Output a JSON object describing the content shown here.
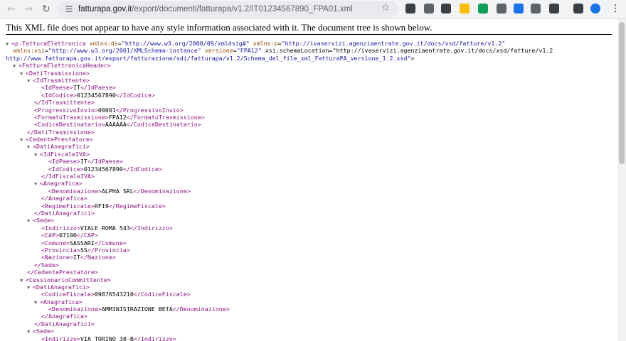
{
  "browser": {
    "url_host": "fatturapa.gov.it",
    "url_path": "/export/documenti/fatturapa/v1.2/IT01234567890_FPA01.xml"
  },
  "icons": {
    "back": "back-arrow-icon",
    "forward": "forward-arrow-icon",
    "reload": "reload-icon",
    "site_info": "tune-icon",
    "bookmark": "star-icon"
  },
  "extensions": [
    {
      "name": "extension-icon-1",
      "color": "#3c4043"
    },
    {
      "name": "extension-icon-2",
      "color": "#5f6368"
    },
    {
      "name": "extension-icon-3",
      "color": "#3c4043"
    },
    {
      "name": "extension-icon-4",
      "color": "#fbbc04"
    },
    {
      "name": "extension-icon-5",
      "color": "#0f9d58"
    },
    {
      "name": "extension-icon-6",
      "color": "#5f6368"
    },
    {
      "name": "extension-icon-7",
      "color": "#1a73e8"
    },
    {
      "name": "extension-icon-8",
      "color": "#5f6368"
    },
    {
      "name": "extension-icon-9",
      "color": "#3c4043"
    },
    {
      "name": "side-panel-icon",
      "color": "#3c4043"
    },
    {
      "name": "profile-avatar-icon",
      "color": "#1a73e8"
    },
    {
      "name": "menu-icon",
      "color": "#5f6368"
    }
  ],
  "page": {
    "header_message": "This XML file does not appear to have any style information associated with it. The document tree is shown below."
  },
  "tree_lines": [
    "▼<p:FatturaElettronica xmlns:ds=\"http://www.w3.org/2000/09/xmldsig#\" xmlns:p=\"http://ivaservizi.agenziaentrate.gov.it/docs/xsd/fatture/v1.2\"",
    "  xmlns:xsi=\"http://www.w3.org/2001/XMLSchema-instance\" versione=\"FPA12\" xsi:schemaLocation=\"http://ivaservizi.agenziaentrate.gov.it/docs/xsd/fatture/v1.2",
    "http://www.fatturapa.gov.it/export/fatturazione/sdi/fatturapa/v1.2/Schema_del_file_xml_FatturaPA_versione_1.2.xsd\">",
    "  ▼<FatturaElettronicaHeader>",
    "    ▼<DatiTrasmissione>",
    "      ▼<IdTrasmittente>",
    "          <IdPaese>IT</IdPaese>",
    "          <IdCodice>01234567890</IdCodice>",
    "        </IdTrasmittente>",
    "        <ProgressivoInvio>00001</ProgressivoInvio>",
    "        <FormatoTrasmissione>FPA12</FormatoTrasmissione>",
    "        <CodiceDestinatario>AAAAAA</CodiceDestinatario>",
    "      </DatiTrasmissione>",
    "    ▼<CedentePrestatore>",
    "      ▼<DatiAnagrafici>",
    "        ▼<IdFiscaleIVA>",
    "            <IdPaese>IT</IdPaese>",
    "            <IdCodice>01234567890</IdCodice>",
    "          </IdFiscaleIVA>",
    "        ▼<Anagrafica>",
    "            <Denominazione>ALPHA SRL</Denominazione>",
    "          </Anagrafica>",
    "          <RegimeFiscale>RF19</RegimeFiscale>",
    "        </DatiAnagrafici>",
    "      ▼<Sede>",
    "          <Indirizzo>VIALE ROMA 543</Indirizzo>",
    "          <CAP>07100</CAP>",
    "          <Comune>SASSARI</Comune>",
    "          <Provincia>SS</Provincia>",
    "          <Nazione>IT</Nazione>",
    "        </Sede>",
    "      </CedentePrestatore>",
    "    ▼<CessionarioCommittente>",
    "      ▼<DatiAnagrafici>",
    "          <CodiceFiscale>09876543210</CodiceFiscale>",
    "        ▼<Anagrafica>",
    "            <Denominazione>AMMINISTRAZIONE BETA</Denominazione>",
    "          </Anagrafica>",
    "        </DatiAnagrafici>",
    "      ▼<Sede>",
    "          <Indirizzo>VIA TORINO 38-B</Indirizzo>"
  ]
}
